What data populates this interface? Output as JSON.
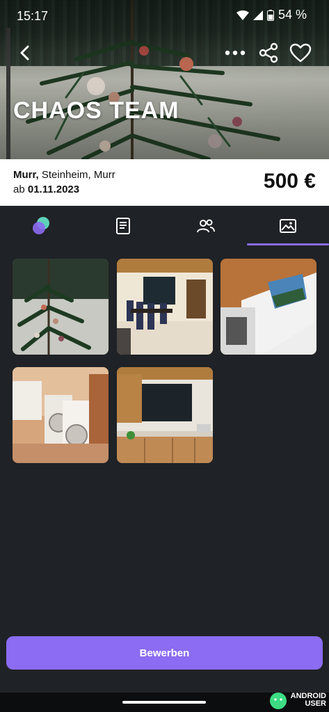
{
  "status": {
    "time": "15:17",
    "battery": "54 %"
  },
  "header": {
    "title": "CHAOS TEAM"
  },
  "listing": {
    "city": "Murr,",
    "address_rest": " Steinheim, Murr",
    "from_prefix": "ab ",
    "from_date": "01.11.2023",
    "price": "500 €"
  },
  "tabs": [
    {
      "icon": "overview-icon"
    },
    {
      "icon": "document-icon"
    },
    {
      "icon": "people-icon"
    },
    {
      "icon": "image-icon",
      "active": true
    }
  ],
  "gallery": [
    {
      "icon": "photo-christmas-tree"
    },
    {
      "icon": "photo-dining-room"
    },
    {
      "icon": "photo-wall-mural"
    },
    {
      "icon": "photo-laundry-room"
    },
    {
      "icon": "photo-kitchen"
    }
  ],
  "cta": {
    "label": "Bewerben"
  },
  "watermark": {
    "line1": "ANDROID",
    "line2": "USER"
  },
  "colors": {
    "accent": "#8b6cf2",
    "background": "#1f2226",
    "info_bg": "#ffffff"
  }
}
